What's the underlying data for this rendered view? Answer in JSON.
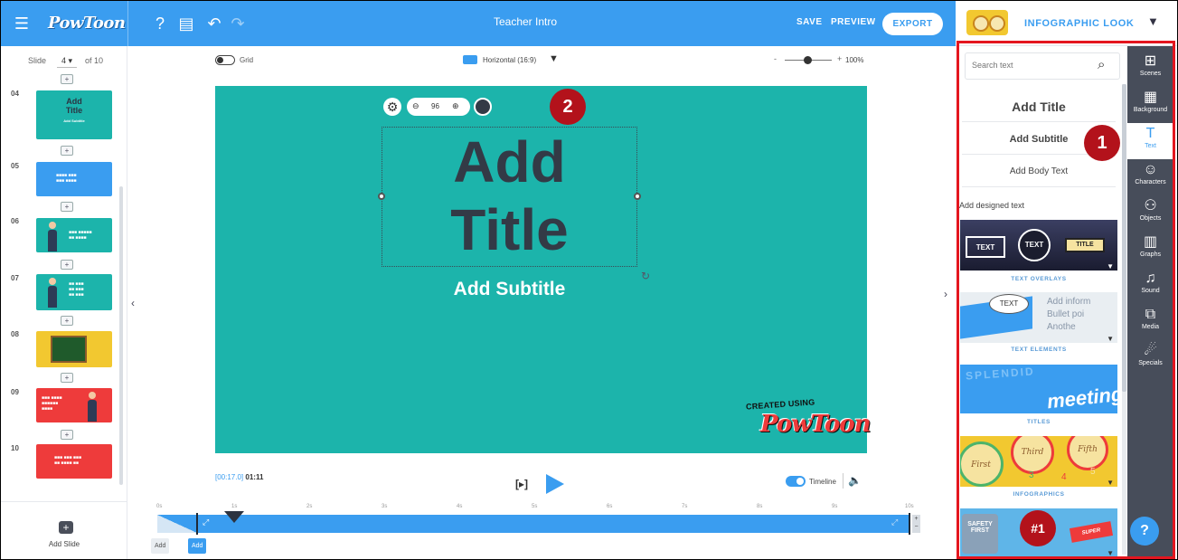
{
  "topbar": {
    "logo": "PowToon",
    "title": "Teacher Intro",
    "save": "SAVE",
    "preview": "PREVIEW",
    "export": "EXPORT",
    "look": "INFOGRAPHIC LOOK",
    "colors": {
      "bar": "#3a9df0"
    }
  },
  "slides": {
    "label": "Slide",
    "current": "4",
    "of": "of 10",
    "items": [
      {
        "num": "04",
        "title": "Add Title",
        "sub": "Add Subtitle",
        "color": "#1cb4ab"
      },
      {
        "num": "05",
        "color": "#3a9df0"
      },
      {
        "num": "06",
        "color": "#1cb4ab"
      },
      {
        "num": "07",
        "color": "#1cb4ab"
      },
      {
        "num": "08",
        "color": "#f2c830"
      },
      {
        "num": "09",
        "color": "#ee3b3b"
      },
      {
        "num": "10",
        "color": "#ee3b3b"
      }
    ],
    "add_slide": "Add Slide"
  },
  "editor": {
    "grid": "Grid",
    "orientation": "Horizontal (16:9)",
    "zoom_minus": "-",
    "zoom_plus": "+",
    "zoom": "100%",
    "font_size": "96",
    "title": [
      "Add",
      "Title"
    ],
    "subtitle": "Add Subtitle",
    "created_using": "CREATED USING",
    "brand": "PowToon",
    "canvas_color": "#1cb4ab"
  },
  "badges": {
    "one": "1",
    "two": "2"
  },
  "playback": {
    "current_time": "[00:17.0]",
    "total": "01:11",
    "step": "[▸]",
    "timeline": "Timeline",
    "ruler": [
      "0s",
      "1s",
      "2s",
      "3s",
      "4s",
      "5s",
      "6s",
      "7s",
      "8s",
      "9s",
      "10s"
    ],
    "add_left": "Add",
    "add_right": "Add"
  },
  "text_panel": {
    "search_placeholder": "Search text",
    "add_title": "Add Title",
    "add_subtitle": "Add Subtitle",
    "add_body": "Add Body Text",
    "designed": "Add designed text",
    "categories": [
      "TEXT OVERLAYS",
      "TEXT ELEMENTS",
      "TITLES",
      "INFOGRAPHICS"
    ],
    "card_text": {
      "overlay_a": "TEXT",
      "overlay_b": "TEXT",
      "overlay_c": "TITLE",
      "elements": "TEXT",
      "bullet1": "Add inform",
      "bullet2": "Bullet poi",
      "bullet3": "Anothe",
      "titles1": "SPLENDID",
      "titles2": "meeting",
      "info1": "First",
      "info2": "Third",
      "info3": "Fifth",
      "info4": "3",
      "info5": "4",
      "info6": "5",
      "safety": "SAFETY FIRST",
      "num1": "#1",
      "super": "SUPER"
    }
  },
  "rail": [
    {
      "label": "Scenes",
      "icon": "⊞"
    },
    {
      "label": "Background",
      "icon": "▦"
    },
    {
      "label": "Text",
      "icon": "T"
    },
    {
      "label": "Characters",
      "icon": "☺"
    },
    {
      "label": "Objects",
      "icon": "⚇"
    },
    {
      "label": "Graphs",
      "icon": "▥"
    },
    {
      "label": "Sound",
      "icon": "♫"
    },
    {
      "label": "Media",
      "icon": "⧉"
    },
    {
      "label": "Specials",
      "icon": "☄"
    }
  ],
  "help": "?"
}
